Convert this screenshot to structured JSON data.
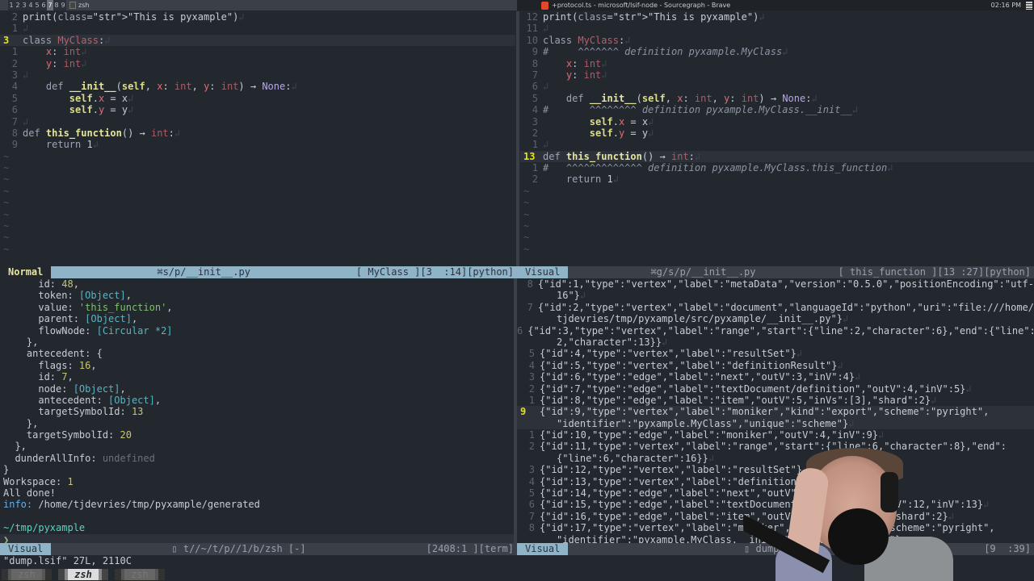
{
  "topbar": {
    "workspaces": [
      "1",
      "2",
      "3",
      "4",
      "5",
      "6",
      "7",
      "8",
      "9"
    ],
    "active_workspace": "7",
    "terminal_title": "zsh",
    "browser_title": "+protocol.ts - microsoft/lsif-node - Sourcegraph - Brave",
    "clock": "02:16 PM"
  },
  "left_editor": {
    "lines": [
      {
        "n": "2",
        "text": "print(\"This is pyxample\")"
      },
      {
        "n": "1",
        "text": ""
      },
      {
        "n": "3",
        "text": "class MyClass:",
        "current": true
      },
      {
        "n": "1",
        "text": "    x: int"
      },
      {
        "n": "2",
        "text": "    y: int"
      },
      {
        "n": "3",
        "text": ""
      },
      {
        "n": "4",
        "text": "    def __init__(self, x: int, y: int) → None:"
      },
      {
        "n": "5",
        "text": "        self.x = x"
      },
      {
        "n": "6",
        "text": "        self.y = y"
      },
      {
        "n": "7",
        "text": ""
      },
      {
        "n": "8",
        "text": "def this_function() → int:"
      },
      {
        "n": "9",
        "text": "    return 1"
      }
    ],
    "tilde_count": 9,
    "status": {
      "mode": "Normal",
      "filename": "s/p/__init__.py",
      "position": "[ MyClass ][3  :14][python]"
    }
  },
  "right_editor": {
    "lines": [
      {
        "n": "12",
        "text": "print(\"This is pyxample\")"
      },
      {
        "n": "11",
        "text": ""
      },
      {
        "n": "10",
        "text": "class MyClass:"
      },
      {
        "n": "9",
        "text": "#     ^^^^^^^ definition pyxample.MyClass"
      },
      {
        "n": "8",
        "text": "    x: int"
      },
      {
        "n": "7",
        "text": "    y: int"
      },
      {
        "n": "6",
        "text": ""
      },
      {
        "n": "5",
        "text": "    def __init__(self, x: int, y: int) → None:"
      },
      {
        "n": "4",
        "text": "#       ^^^^^^^^ definition pyxample.MyClass.__init__"
      },
      {
        "n": "3",
        "text": "        self.x = x"
      },
      {
        "n": "2",
        "text": "        self.y = y"
      },
      {
        "n": "1",
        "text": ""
      },
      {
        "n": "13",
        "text": "def this_function() → int:",
        "current": true
      },
      {
        "n": "1",
        "text": "#   ^^^^^^^^^^^^^ definition pyxample.MyClass.this_function"
      },
      {
        "n": "2",
        "text": "    return 1"
      }
    ],
    "tilde_count": 6,
    "status": {
      "mode": "Visual",
      "filename": "g/s/p/__init__.py",
      "position": "[ this_function ][13 :27][python]"
    }
  },
  "terminal": {
    "lines": [
      "      id: 48,",
      "      token: [Object],",
      "      value: 'this_function',",
      "      parent: [Object],",
      "      flowNode: [Circular *2]",
      "    },",
      "    antecedent: {",
      "      flags: 16,",
      "      id: 7,",
      "      node: [Object],",
      "      antecedent: [Object],",
      "      targetSymbolId: 13",
      "    },",
      "    targetSymbolId: 20",
      "  },",
      "  dunderAllInfo: undefined",
      "}",
      "Workspace: 1",
      "All done!",
      "info: /home/tjdevries/tmp/pyxample/generated",
      "",
      "~/tmp/pyxample",
      "❯"
    ],
    "status": {
      "mode": "Visual",
      "filename": "t//~/t/p//1/b/zsh [-]",
      "position": "[2408:1 ][term]"
    }
  },
  "lsif_dump": {
    "lines": [
      {
        "n": "8",
        "text": "{\"id\":1,\"type\":\"vertex\",\"label\":\"metaData\",\"version\":\"0.5.0\",\"positionEncoding\":\"utf-",
        "cont": "16\"}"
      },
      {
        "n": "7",
        "text": "{\"id\":2,\"type\":\"vertex\",\"label\":\"document\",\"languageId\":\"python\",\"uri\":\"file:///home/",
        "cont": "tjdevries/tmp/pyxample/src/pyxample/__init__.py\"}"
      },
      {
        "n": "6",
        "text": "{\"id\":3,\"type\":\"vertex\",\"label\":\"range\",\"start\":{\"line\":2,\"character\":6},\"end\":{\"line\":",
        "cont": "2,\"character\":13}}"
      },
      {
        "n": "5",
        "text": "{\"id\":4,\"type\":\"vertex\",\"label\":\"resultSet\"}"
      },
      {
        "n": "4",
        "text": "{\"id\":5,\"type\":\"vertex\",\"label\":\"definitionResult\"}"
      },
      {
        "n": "3",
        "text": "{\"id\":6,\"type\":\"edge\",\"label\":\"next\",\"outV\":3,\"inV\":4}"
      },
      {
        "n": "2",
        "text": "{\"id\":7,\"type\":\"edge\",\"label\":\"textDocument/definition\",\"outV\":4,\"inV\":5}"
      },
      {
        "n": "1",
        "text": "{\"id\":8,\"type\":\"edge\",\"label\":\"item\",\"outV\":5,\"inVs\":[3],\"shard\":2}"
      },
      {
        "n": "9",
        "text": "{\"id\":9,\"type\":\"vertex\",\"label\":\"moniker\",\"kind\":\"export\",\"scheme\":\"pyright\",",
        "cont": "\"identifier\":\"pyxample.MyClass\",\"unique\":\"scheme\"}",
        "current": true
      },
      {
        "n": "1",
        "text": "{\"id\":10,\"type\":\"edge\",\"label\":\"moniker\",\"outV\":4,\"inV\":9}"
      },
      {
        "n": "2",
        "text": "{\"id\":11,\"type\":\"vertex\",\"label\":\"range\",\"start\":{\"line\":6,\"character\":8},\"end\":",
        "cont": "{\"line\":6,\"character\":16}}"
      },
      {
        "n": "3",
        "text": "{\"id\":12,\"type\":\"vertex\",\"label\":\"resultSet\"}"
      },
      {
        "n": "4",
        "text": "{\"id\":13,\"type\":\"vertex\",\"label\":\"definitionResult\"}"
      },
      {
        "n": "5",
        "text": "{\"id\":14,\"type\":\"edge\",\"label\":\"next\",\"outV\":12,\"inV\":13}"
      },
      {
        "n": "6",
        "text": "{\"id\":15,\"type\":\"edge\",\"label\":\"textDocument/definition\",\"outV\":12,\"inV\":13}"
      },
      {
        "n": "7",
        "text": "{\"id\":16,\"type\":\"edge\",\"label\":\"item\",\"outV\":13,\"inVs\":[11],\"shard\":2}"
      },
      {
        "n": "8",
        "text": "{\"id\":17,\"type\":\"vertex\",\"label\":\"moniker\",\"kind\":\"export\",\"scheme\":\"pyright\",",
        "cont": "\"identifier\":\"pyxample.MyClass.__init__\",\"unique\":\"scheme\"}"
      }
    ],
    "status": {
      "mode": "Visual",
      "filename": "dump.lsif",
      "position": "[9  :39]"
    }
  },
  "cmdline": "\"dump.lsif\" 27L, 2110C",
  "tabs": [
    {
      "label": "zsh",
      "active": false
    },
    {
      "label": "zsh",
      "active": true
    },
    {
      "label": "zsh",
      "active": false
    }
  ]
}
